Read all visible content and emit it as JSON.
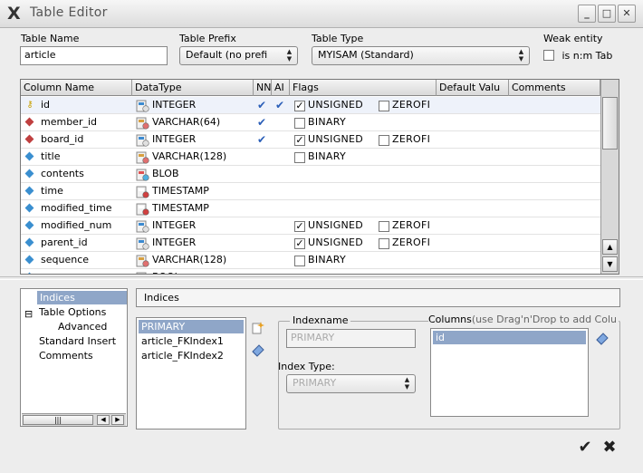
{
  "window": {
    "title": "Table Editor",
    "minimize": "_",
    "maximize": "□",
    "close": "✕"
  },
  "form": {
    "table_name": {
      "label": "Table Name",
      "value": "article"
    },
    "table_prefix": {
      "label": "Table Prefix",
      "value": "Default (no prefi"
    },
    "table_type": {
      "label": "Table Type",
      "value": "MYISAM  (Standard)"
    },
    "weak_entity": {
      "label": "Weak entity",
      "checkbox_label": "is n:m Tab"
    }
  },
  "grid": {
    "headers": [
      "Column Name",
      "DataType",
      "NN",
      "AI",
      "Flags",
      "Default Valu",
      "Comments"
    ],
    "rows": [
      {
        "name": "id",
        "icon": "key-icon",
        "type": "INTEGER",
        "type_icon": "number-type-icon",
        "nn": "✔",
        "ai": "✔",
        "flag1": "UNSIGNED",
        "flag1_checked": true,
        "flag2": "ZEROFI",
        "selected": true
      },
      {
        "name": "member_id",
        "icon": "foreign-key-icon",
        "type": "VARCHAR(64)",
        "type_icon": "string-type-icon",
        "nn": "✔",
        "ai": "",
        "flag1": "BINARY",
        "flag1_checked": false,
        "flag2": "",
        "selected": false
      },
      {
        "name": "board_id",
        "icon": "foreign-key-icon",
        "type": "INTEGER",
        "type_icon": "number-type-icon",
        "nn": "✔",
        "ai": "",
        "flag1": "UNSIGNED",
        "flag1_checked": true,
        "flag2": "ZEROFI",
        "selected": false
      },
      {
        "name": "title",
        "icon": "column-icon",
        "type": "VARCHAR(128)",
        "type_icon": "string-type-icon",
        "nn": "",
        "ai": "",
        "flag1": "BINARY",
        "flag1_checked": false,
        "flag2": "",
        "selected": false
      },
      {
        "name": "contents",
        "icon": "column-icon",
        "type": "BLOB",
        "type_icon": "blob-type-icon",
        "nn": "",
        "ai": "",
        "flag1": "",
        "flag1_checked": false,
        "flag2": "",
        "selected": false
      },
      {
        "name": "time",
        "icon": "column-icon",
        "type": "TIMESTAMP",
        "type_icon": "datetime-type-icon",
        "nn": "",
        "ai": "",
        "flag1": "",
        "flag1_checked": false,
        "flag2": "",
        "selected": false
      },
      {
        "name": "modified_time",
        "icon": "column-icon",
        "type": "TIMESTAMP",
        "type_icon": "datetime-type-icon",
        "nn": "",
        "ai": "",
        "flag1": "",
        "flag1_checked": false,
        "flag2": "",
        "selected": false
      },
      {
        "name": "modified_num",
        "icon": "column-icon",
        "type": "INTEGER",
        "type_icon": "number-type-icon",
        "nn": "",
        "ai": "",
        "flag1": "UNSIGNED",
        "flag1_checked": true,
        "flag2": "ZEROFI",
        "selected": false
      },
      {
        "name": "parent_id",
        "icon": "column-icon",
        "type": "INTEGER",
        "type_icon": "number-type-icon",
        "nn": "",
        "ai": "",
        "flag1": "UNSIGNED",
        "flag1_checked": true,
        "flag2": "ZEROFI",
        "selected": false
      },
      {
        "name": "sequence",
        "icon": "column-icon",
        "type": "VARCHAR(128)",
        "type_icon": "string-type-icon",
        "nn": "",
        "ai": "",
        "flag1": "BINARY",
        "flag1_checked": false,
        "flag2": "",
        "selected": false
      },
      {
        "name": "",
        "icon": "column-icon",
        "type": "BOOL",
        "type_icon": "number-type-icon",
        "nn": "",
        "ai": "",
        "flag1": "",
        "flag1_checked": false,
        "flag2": "",
        "selected": false
      }
    ]
  },
  "tree": {
    "items": [
      "Indices",
      "Table Options",
      "Advanced",
      "Standard Insert",
      "Comments"
    ],
    "selected": "Indices"
  },
  "indices": {
    "panel_title": "Indices",
    "list": [
      "PRIMARY",
      "article_FKIndex1",
      "article_FKIndex2"
    ],
    "indexname_label": "Indexname",
    "indexname_value": "PRIMARY",
    "index_type_label": "Index Type:",
    "index_type_value": "PRIMARY",
    "columns_label": "Columns",
    "columns_hint": "(use Drag'n'Drop to add Colu",
    "columns": [
      "id"
    ]
  },
  "colors": {
    "selection": "#8fa6c8",
    "check": "#2b5fb8",
    "key": "#c8a000",
    "fk": "#c04040",
    "col": "#3a8fd0"
  }
}
